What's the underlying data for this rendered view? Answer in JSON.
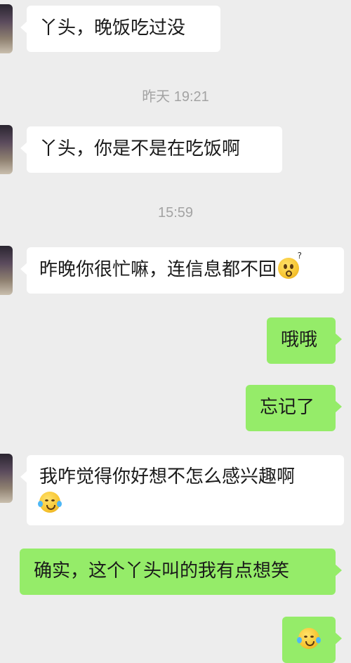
{
  "messages": [
    {
      "side": "in",
      "text": "丫头，晚饭吃过没"
    },
    {
      "timestamp": "昨天 19:21"
    },
    {
      "side": "in",
      "text": "丫头，你是不是在吃饭啊"
    },
    {
      "timestamp": "15:59"
    },
    {
      "side": "in",
      "text": "昨晚你很忙嘛，连信息都不回",
      "emoji": "thinking-face-emoji"
    },
    {
      "side": "out",
      "text": "哦哦"
    },
    {
      "side": "out",
      "text": "忘记了"
    },
    {
      "side": "in",
      "text": "我咋觉得你好想不怎么感兴趣啊",
      "emoji": "crying-laughing-emoji"
    },
    {
      "side": "out",
      "text": "确实，这个丫头叫的我有点想笑"
    },
    {
      "side": "out",
      "text": "",
      "emoji": "crying-laughing-emoji"
    }
  ],
  "colors": {
    "background": "#ededed",
    "incoming_bubble": "#ffffff",
    "outgoing_bubble": "#95ec69",
    "timestamp_text": "#a3a3a3"
  }
}
